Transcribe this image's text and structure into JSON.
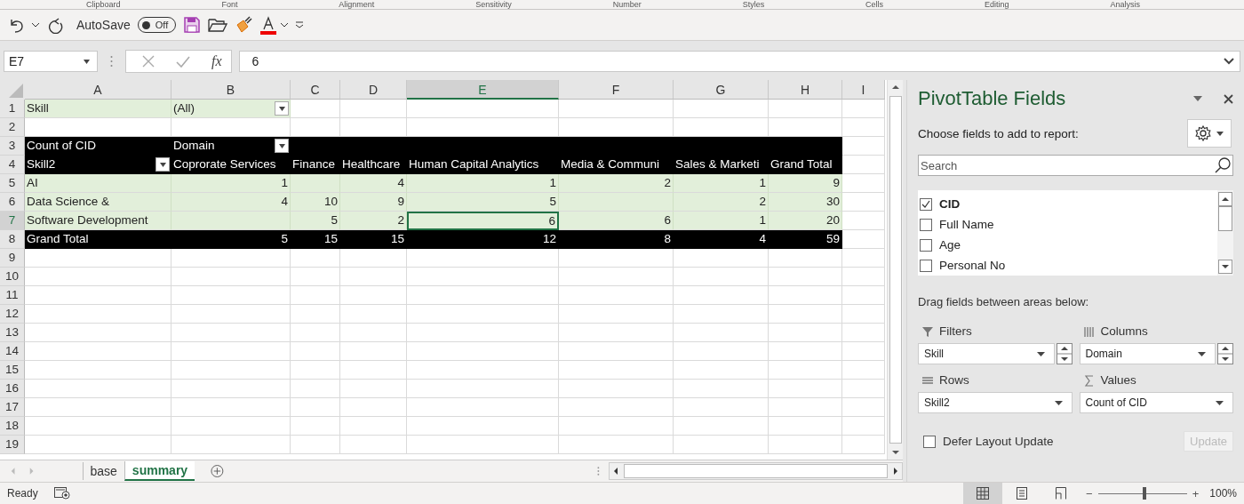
{
  "ribbon_groups": [
    "Clipboard",
    "Font",
    "Alignment",
    "Sensitivity",
    "Number",
    "Styles",
    "Cells",
    "Editing",
    "Analysis"
  ],
  "quick_access": {
    "autosave_label": "AutoSave",
    "autosave_toggle": {
      "on": false,
      "label": "Off"
    }
  },
  "formula_bar": {
    "name_box": "E7",
    "function_label": "fx",
    "value": "6"
  },
  "sheet": {
    "columns": [
      {
        "label": "A",
        "selected": false
      },
      {
        "label": "B",
        "selected": false
      },
      {
        "label": "C",
        "selected": false
      },
      {
        "label": "D",
        "selected": false
      },
      {
        "label": "E",
        "selected": true
      },
      {
        "label": "F",
        "selected": false
      },
      {
        "label": "G",
        "selected": false
      },
      {
        "label": "H",
        "selected": false
      },
      {
        "label": "I",
        "selected": false
      }
    ],
    "rows": [
      {
        "number": "1",
        "kind": "filter",
        "selected": false,
        "cells": [
          {
            "kind": "text",
            "text": "Skill",
            "selected": false
          },
          {
            "kind": "dropdown",
            "text": "(All)",
            "selected": false
          }
        ]
      },
      {
        "number": "2",
        "kind": "blank",
        "selected": false,
        "cells": []
      },
      {
        "number": "3",
        "kind": "header",
        "selected": false,
        "cells": [
          {
            "kind": "text",
            "text": "Count of CID",
            "selected": false
          },
          {
            "kind": "dropdown",
            "text": "Domain",
            "selected": false
          }
        ]
      },
      {
        "number": "4",
        "kind": "header",
        "selected": false,
        "cells": [
          {
            "kind": "dropdown",
            "text": "Skill2",
            "selected": false
          },
          {
            "kind": "text",
            "text": "Coprorate Services",
            "selected": false
          },
          {
            "kind": "text",
            "text": "Finance",
            "selected": false
          },
          {
            "kind": "text",
            "text": "Healthcare",
            "selected": false
          },
          {
            "kind": "text",
            "text": "Human Capital Analytics",
            "selected": false
          },
          {
            "kind": "text",
            "text": "Media & Communi",
            "selected": false
          },
          {
            "kind": "text",
            "text": "Sales & Marketi",
            "selected": false
          },
          {
            "kind": "text",
            "text": "Grand Total",
            "selected": false
          }
        ]
      },
      {
        "number": "5",
        "kind": "body",
        "selected": false,
        "cells": [
          {
            "kind": "text",
            "text": "AI",
            "selected": false
          },
          {
            "kind": "number",
            "text": "1",
            "selected": false
          },
          {
            "kind": "empty",
            "selected": false
          },
          {
            "kind": "number",
            "text": "4",
            "selected": false
          },
          {
            "kind": "number",
            "text": "1",
            "selected": false
          },
          {
            "kind": "number",
            "text": "2",
            "selected": false
          },
          {
            "kind": "number",
            "text": "1",
            "selected": false
          },
          {
            "kind": "number",
            "text": "9",
            "selected": false
          }
        ]
      },
      {
        "number": "6",
        "kind": "body",
        "selected": false,
        "cells": [
          {
            "kind": "text",
            "text": "Data Science &",
            "selected": false
          },
          {
            "kind": "number",
            "text": "4",
            "selected": false
          },
          {
            "kind": "number",
            "text": "10",
            "selected": false
          },
          {
            "kind": "number",
            "text": "9",
            "selected": false
          },
          {
            "kind": "number",
            "text": "5",
            "selected": false
          },
          {
            "kind": "empty",
            "selected": false
          },
          {
            "kind": "number",
            "text": "2",
            "selected": false
          },
          {
            "kind": "number",
            "text": "30",
            "selected": false
          }
        ]
      },
      {
        "number": "7",
        "kind": "body",
        "selected": true,
        "cells": [
          {
            "kind": "text",
            "text": "Software Development",
            "selected": false
          },
          {
            "kind": "empty",
            "selected": false
          },
          {
            "kind": "number",
            "text": "5",
            "selected": false
          },
          {
            "kind": "number",
            "text": "2",
            "selected": false
          },
          {
            "kind": "number",
            "text": "6",
            "selected": true
          },
          {
            "kind": "number",
            "text": "6",
            "selected": false
          },
          {
            "kind": "number",
            "text": "1",
            "selected": false
          },
          {
            "kind": "number",
            "text": "20",
            "selected": false
          }
        ]
      },
      {
        "number": "8",
        "kind": "total",
        "selected": false,
        "cells": [
          {
            "kind": "text",
            "text": "Grand Total",
            "selected": false
          },
          {
            "kind": "number",
            "text": "5",
            "selected": false
          },
          {
            "kind": "number",
            "text": "15",
            "selected": false
          },
          {
            "kind": "number",
            "text": "15",
            "selected": false
          },
          {
            "kind": "number",
            "text": "12",
            "selected": false
          },
          {
            "kind": "number",
            "text": "8",
            "selected": false
          },
          {
            "kind": "number",
            "text": "4",
            "selected": false
          },
          {
            "kind": "number",
            "text": "59",
            "selected": false
          }
        ]
      },
      {
        "number": "9",
        "kind": "blank",
        "selected": false,
        "cells": []
      },
      {
        "number": "10",
        "kind": "blank",
        "selected": false,
        "cells": []
      },
      {
        "number": "11",
        "kind": "blank",
        "selected": false,
        "cells": []
      },
      {
        "number": "12",
        "kind": "blank",
        "selected": false,
        "cells": []
      },
      {
        "number": "13",
        "kind": "blank",
        "selected": false,
        "cells": []
      },
      {
        "number": "14",
        "kind": "blank",
        "selected": false,
        "cells": []
      },
      {
        "number": "15",
        "kind": "blank",
        "selected": false,
        "cells": []
      },
      {
        "number": "16",
        "kind": "blank",
        "selected": false,
        "cells": []
      },
      {
        "number": "17",
        "kind": "blank",
        "selected": false,
        "cells": []
      },
      {
        "number": "18",
        "kind": "blank",
        "selected": false,
        "cells": []
      },
      {
        "number": "19",
        "kind": "blank",
        "selected": false,
        "cells": []
      }
    ]
  },
  "sheet_tabs": [
    {
      "label": "base",
      "selected": false
    },
    {
      "label": "summary",
      "selected": true
    }
  ],
  "pivot_pane": {
    "title": "PivotTable Fields",
    "subtitle": "Choose fields to add to report:",
    "search": {
      "placeholder": "Search"
    },
    "fields": [
      {
        "label": "CID",
        "checked": true
      },
      {
        "label": "Full Name",
        "checked": false
      },
      {
        "label": "Age",
        "checked": false
      },
      {
        "label": "Personal No",
        "checked": false
      }
    ],
    "areas_hint": "Drag fields between areas below:",
    "areas": [
      {
        "kind": "filters",
        "label": "Filters",
        "value": "Skill",
        "spinner": true
      },
      {
        "kind": "columns",
        "label": "Columns",
        "value": "Domain",
        "spinner": true
      },
      {
        "kind": "rows",
        "label": "Rows",
        "value": "Skill2",
        "spinner": false
      },
      {
        "kind": "values",
        "label": "Values",
        "value": "Count of CID",
        "spinner": false
      }
    ],
    "defer": {
      "label": "Defer Layout Update",
      "checked": false
    },
    "update_button": {
      "label": "Update",
      "disabled": true
    }
  },
  "status_bar": {
    "status": "Ready",
    "views": [
      {
        "kind": "normal",
        "selected": true
      },
      {
        "kind": "page-layout",
        "selected": false
      },
      {
        "kind": "page-break",
        "selected": false
      }
    ],
    "zoom_out": "−",
    "zoom_in": "+",
    "zoom": {
      "level": 0.52
    },
    "zoom_label": "100%"
  }
}
